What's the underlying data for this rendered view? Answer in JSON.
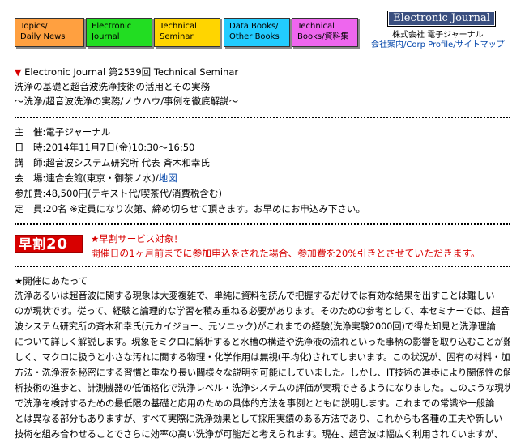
{
  "nav": {
    "buttons": [
      {
        "line1": "Topics/",
        "line2": "Daily News",
        "color": "#ffa040"
      },
      {
        "line1": "Electronic",
        "line2": "Journal",
        "color": "#22dd22"
      },
      {
        "line1": "Technical",
        "line2": "Seminar",
        "color": "#ffd500"
      },
      {
        "line1": "Data Books/",
        "line2": "Other Books",
        "color": "#22ccff"
      },
      {
        "line1": "Technical",
        "line2": "Books/資料集",
        "color": "#ee66ee"
      }
    ]
  },
  "brand": {
    "logo": "Electronic Journal",
    "company": "株式会社 電子ジャーナル",
    "links": [
      "会社案内",
      "Corp Profile",
      "サイトマップ"
    ]
  },
  "seminar": {
    "header": "Electronic Journal 第2539回 Technical Seminar",
    "title": "洗浄の基礎と超音波洗浄技術の活用とその実務",
    "subtitle": "～洗浄/超音波洗浄の実務/ノウハウ/事例を徹底解説～"
  },
  "details": {
    "organizer_label": "主　催:",
    "organizer": "電子ジャーナル",
    "date_label": "日　時:",
    "date": "2014年11月7日(金)10:30～16:50",
    "lecturer_label": "講　師:",
    "lecturer": "超音波システム研究所 代表 斉木和幸氏",
    "venue_label": "会　場:",
    "venue": "連合会館(東京・御茶ノ水)/",
    "venue_map": "地図",
    "fee_label": "参加費:",
    "fee": "48,500円(テキスト代/喫茶代/消費税含む)",
    "capacity_label": "定　員:",
    "capacity": "20名 ※定員になり次第、締め切らせて頂きます。お早めにお申込み下さい。"
  },
  "early": {
    "badge_text": "早割",
    "badge_num": "20",
    "headline": "★早割サービス対象！",
    "body": "開催日の1ヶ月前までに参加申込をされた場合、参加費を20%引きとさせていただきます。"
  },
  "intro": {
    "heading": "★開催にあたって",
    "lines": [
      "洗浄あるいは超音波に関する現象は大変複雑で、単純に資料を読んで把握するだけでは有効な結果を出すことは難しい",
      "のが現状です。従って、経験と論理的な学習を積み重ねる必要があります。そのための参考として、本セミナーでは、超音",
      "波システム研究所の斉木和幸氏(元カイジョー、元ソニック)がこれまでの経験(洗浄実験2000回)で得た知見と洗浄理論",
      "について詳しく解説します。現象をミクロに解析すると水槽の構造や洗浄液の流れといった事柄の影響を取り込むことが難",
      "しく、マクロに扱うと小さな汚れに関する物理・化学作用は無視(平均化)されてしまいます。この状況が、固有の材料・加工",
      "方法・洗浄液を秘密にする習慣と重なり長い間様々な説明を可能にしていました。しかし、IT技術の進歩により関係性の解",
      "析技術の進歩と、計測機器の低価格化で洗浄レベル・洗浄システムの評価が実現できるようになりました。このような現状",
      "で洗浄を検討するための最低限の基礎と応用のための具体的方法を事例とともに説明します。これまでの常識や一般論",
      "とは異なる部分もありますが、すべて実際に洗浄効果として採用実績のある方法であり、これからも各種の工夫や新しい",
      "技術を組み合わせることでさらに効率の高い洗浄が可能だと考えられます。現在、超音波は幅広く利用されていますが、"
    ]
  }
}
